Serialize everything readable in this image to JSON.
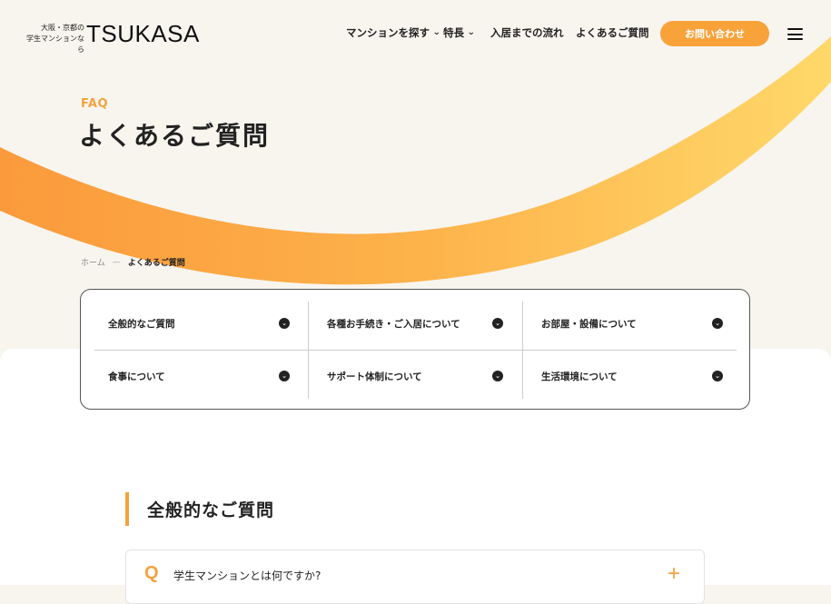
{
  "logo": {
    "small_line1": "大阪・京都の",
    "small_line2": "学生マンションなら",
    "brand": "TSUKASA"
  },
  "nav": {
    "items": [
      {
        "label": "マンションを探す",
        "has_dropdown": true
      },
      {
        "label": "特長",
        "has_dropdown": true
      },
      {
        "label": "入居までの流れ",
        "has_dropdown": false
      },
      {
        "label": "よくあるご質問",
        "has_dropdown": false
      }
    ],
    "dropdown_icon": "⌄",
    "cta_label": "お問い合わせ",
    "menu_icon": "hamburger-icon"
  },
  "hero": {
    "eyebrow": "FAQ",
    "title": "よくあるご質問"
  },
  "breadcrumb": {
    "home": "ホーム",
    "separator": "—",
    "current": "よくあるご質問"
  },
  "categories": [
    {
      "label": "全般的なご質問"
    },
    {
      "label": "各種お手続き・ご入居について"
    },
    {
      "label": "お部屋・設備について"
    },
    {
      "label": "食事について"
    },
    {
      "label": "サポート体制について"
    },
    {
      "label": "生活環境について"
    }
  ],
  "category_icon": "⌄",
  "section": {
    "title": "全般的なご質問"
  },
  "faq": [
    {
      "marker": "Q",
      "question": "学生マンションとは何ですか?",
      "toggle": "+"
    }
  ],
  "colors": {
    "accent": "#f4a23d",
    "cta": "#f8a23a",
    "background": "#f8f5ef"
  }
}
